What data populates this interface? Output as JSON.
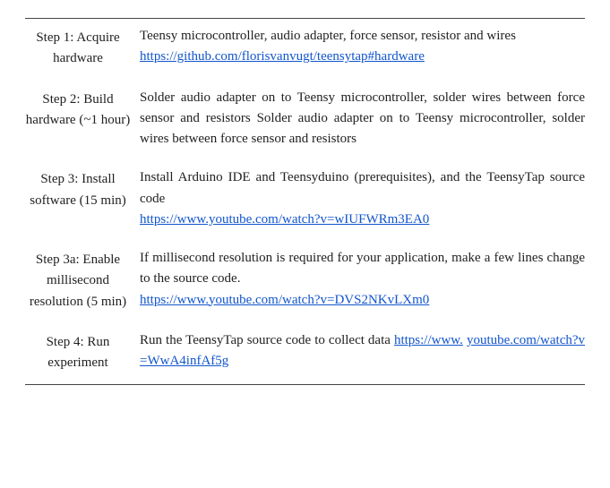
{
  "rows": [
    {
      "label": "Step 1: Acquire hardware",
      "desc": "Teensy microcontroller, audio adapter, force sensor, resistor and wires",
      "desc_trail": "",
      "link": "https://github.com/florisvanvugt/teensytap#hardware",
      "link_break": false
    },
    {
      "label": "Step 2: Build hardware (~1 hour)",
      "desc": "Solder audio adapter on to Teensy microcontroller, solder wires between force sensor and resistors Solder audio adapter on to Teensy microcontroller, solder wires between force sensor and resistors",
      "desc_trail": "",
      "link": "",
      "link_break": false
    },
    {
      "label": "Step 3: Install software (15 min)",
      "desc": "Install Arduino IDE and Teensyduino (prerequisites), and the TeensyTap source code",
      "desc_trail": "",
      "link": "https://www.youtube.com/watch?v=wIUFWRm3EA0",
      "link_break": false
    },
    {
      "label": "Step 3a: Enable millisecond resolution (5 min)",
      "desc": "If millisecond resolution is required for your application, make a few lines change to the source code.",
      "desc_trail": "",
      "link": "https://www.youtube.com/watch?v=DVS2NKvLXm0",
      "link_break": false
    },
    {
      "label": "Step 4: Run experiment",
      "desc": "Run the TeensyTap source code to collect data ",
      "desc_trail": "https://www.",
      "link": "youtube.com/watch?v=WwA4infAf5g",
      "link_break": true
    }
  ]
}
